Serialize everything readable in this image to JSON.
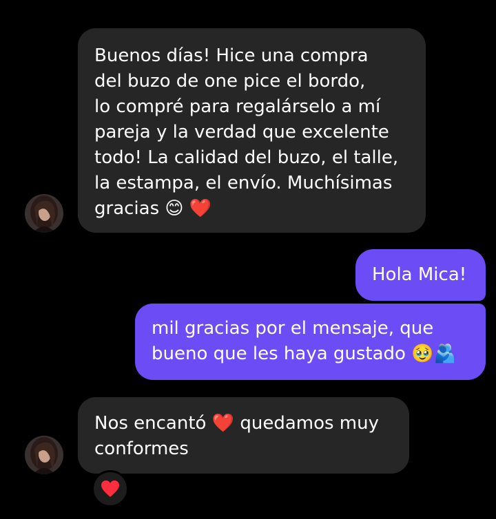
{
  "conversation": {
    "messages": [
      {
        "sender": "contact",
        "text": "Buenos días! Hice una compra\ndel buzo de one pice el bordo,\nlo compré para regalárselo a mí\npareja y la verdad que excelente\ntodo! La calidad del buzo, el talle,\nla estampa, el envío. Muchísimas\ngracias 😊 ❤️"
      },
      {
        "sender": "me",
        "text": "Hola Mica!"
      },
      {
        "sender": "me",
        "text": "mil gracias por el mensaje, que\nbueno que les haya gustado 🥹🫂"
      },
      {
        "sender": "contact",
        "text": "Nos encantó ❤️ quedamos muy\nconformes"
      }
    ],
    "last_message_reaction": "❤️"
  },
  "colors": {
    "background": "#000000",
    "incoming_bubble": "#262626",
    "outgoing_bubble": "#6c4cf5",
    "text": "#ffffff"
  },
  "icons": {
    "avatar": "contact-avatar-photo",
    "reaction": "red-heart-emoji"
  }
}
